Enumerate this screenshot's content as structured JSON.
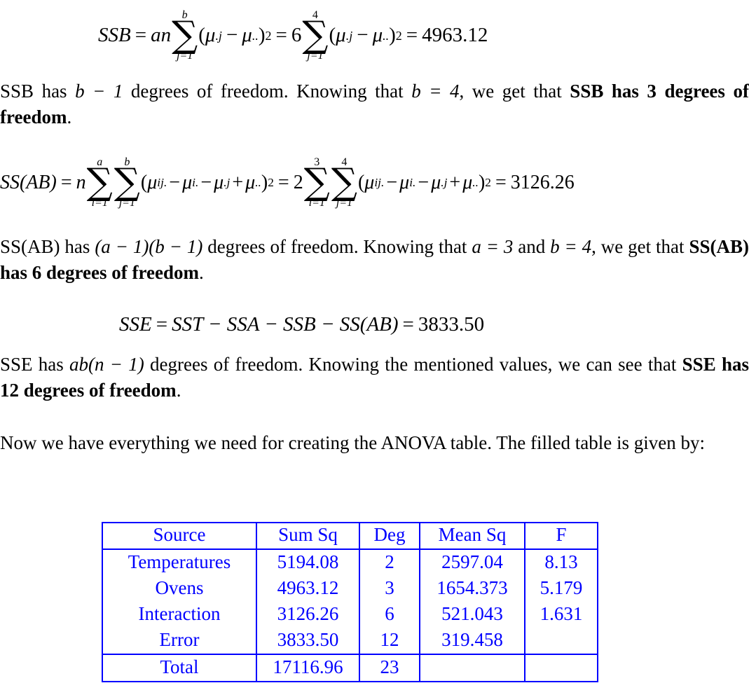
{
  "document": {
    "type": "anova-lecture-notes",
    "text_color": "#000000",
    "table_color": "#0000ff",
    "background": "#ffffff"
  },
  "equations": {
    "ssb": {
      "lhs": "SSB",
      "coef_symbolic": "an",
      "coef_numeric": "6",
      "sum_upper_symbolic": "b",
      "sum_upper_numeric": "4",
      "sum_lower": "j=1",
      "term": "(μ.j − μ..)²",
      "result": "4963.12",
      "plain": "SSB = an ∑(j=1..b) (μ.j − μ..)² = 6 ∑(j=1..4) (μ.j − μ..)² = 4963.12"
    },
    "ssab": {
      "lhs": "SS(AB)",
      "coef_symbolic": "n",
      "coef_numeric": "2",
      "sum1_upper_symbolic": "a",
      "sum1_upper_numeric": "3",
      "sum1_lower": "i=1",
      "sum2_upper_symbolic": "b",
      "sum2_upper_numeric": "4",
      "sum2_lower": "j=1",
      "term": "(μij. − μi. − μ.j + μ..)²",
      "result": "3126.26",
      "plain": "SS(AB) = n ∑(i=1..a) ∑(j=1..b) (μij. − μi. − μ.j + μ..)² = 2 ∑(i=1..3) ∑(j=1..4) (μij. − μi. − μ.j + μ..)² = 3126.26"
    },
    "sse": {
      "lhs": "SSE",
      "rhs": "SST − SSA − SSB − SS(AB)",
      "result": "3833.50",
      "plain": "SSE = SST − SSA − SSB − SS(AB) = 3833.50"
    }
  },
  "paragraphs": {
    "ssb_df": {
      "part1": "SSB has ",
      "math1": "b − 1",
      "part2": " degrees of freedom.  Knowing that ",
      "math2": "b = 4",
      "part3": ", we get that ",
      "bold": "SSB has 3 degrees of freedom",
      "part4": "."
    },
    "ssab_df": {
      "part1": "SS(AB) has ",
      "math1": "(a − 1)(b − 1)",
      "part2": " degrees of freedom.  Knowing that ",
      "math2": "a = 3",
      "part3": " and ",
      "math3": "b = 4",
      "part4": ", we get that  ",
      "bold": "SS(AB) has 6 degrees of freedom",
      "part5": "."
    },
    "sse_df": {
      "part1": "SSE has ",
      "math1": "ab(n − 1)",
      "part2": " degrees of freedom.  Knowing the mentioned values, we can see that ",
      "bold": "SSE has 12 degrees of freedom",
      "part3": "."
    },
    "intro_table": {
      "text": "Now we have everything we need for creating the ANOVA table.  The filled table is given by:"
    }
  },
  "anova_table": {
    "headers": [
      "Source",
      "Sum Sq",
      "Deg",
      "Mean Sq",
      "F"
    ],
    "rows": [
      {
        "source": "Temperatures",
        "sum_sq": "5194.08",
        "deg": "2",
        "mean_sq": "2597.04",
        "f": "8.13"
      },
      {
        "source": "Ovens",
        "sum_sq": "4963.12",
        "deg": "3",
        "mean_sq": "1654.373",
        "f": "5.179"
      },
      {
        "source": "Interaction",
        "sum_sq": "3126.26",
        "deg": "6",
        "mean_sq": "521.043",
        "f": "1.631"
      },
      {
        "source": "Error",
        "sum_sq": "3833.50",
        "deg": "12",
        "mean_sq": "319.458",
        "f": ""
      }
    ],
    "total": {
      "source": "Total",
      "sum_sq": "17116.96",
      "deg": "23",
      "mean_sq": "",
      "f": ""
    }
  }
}
